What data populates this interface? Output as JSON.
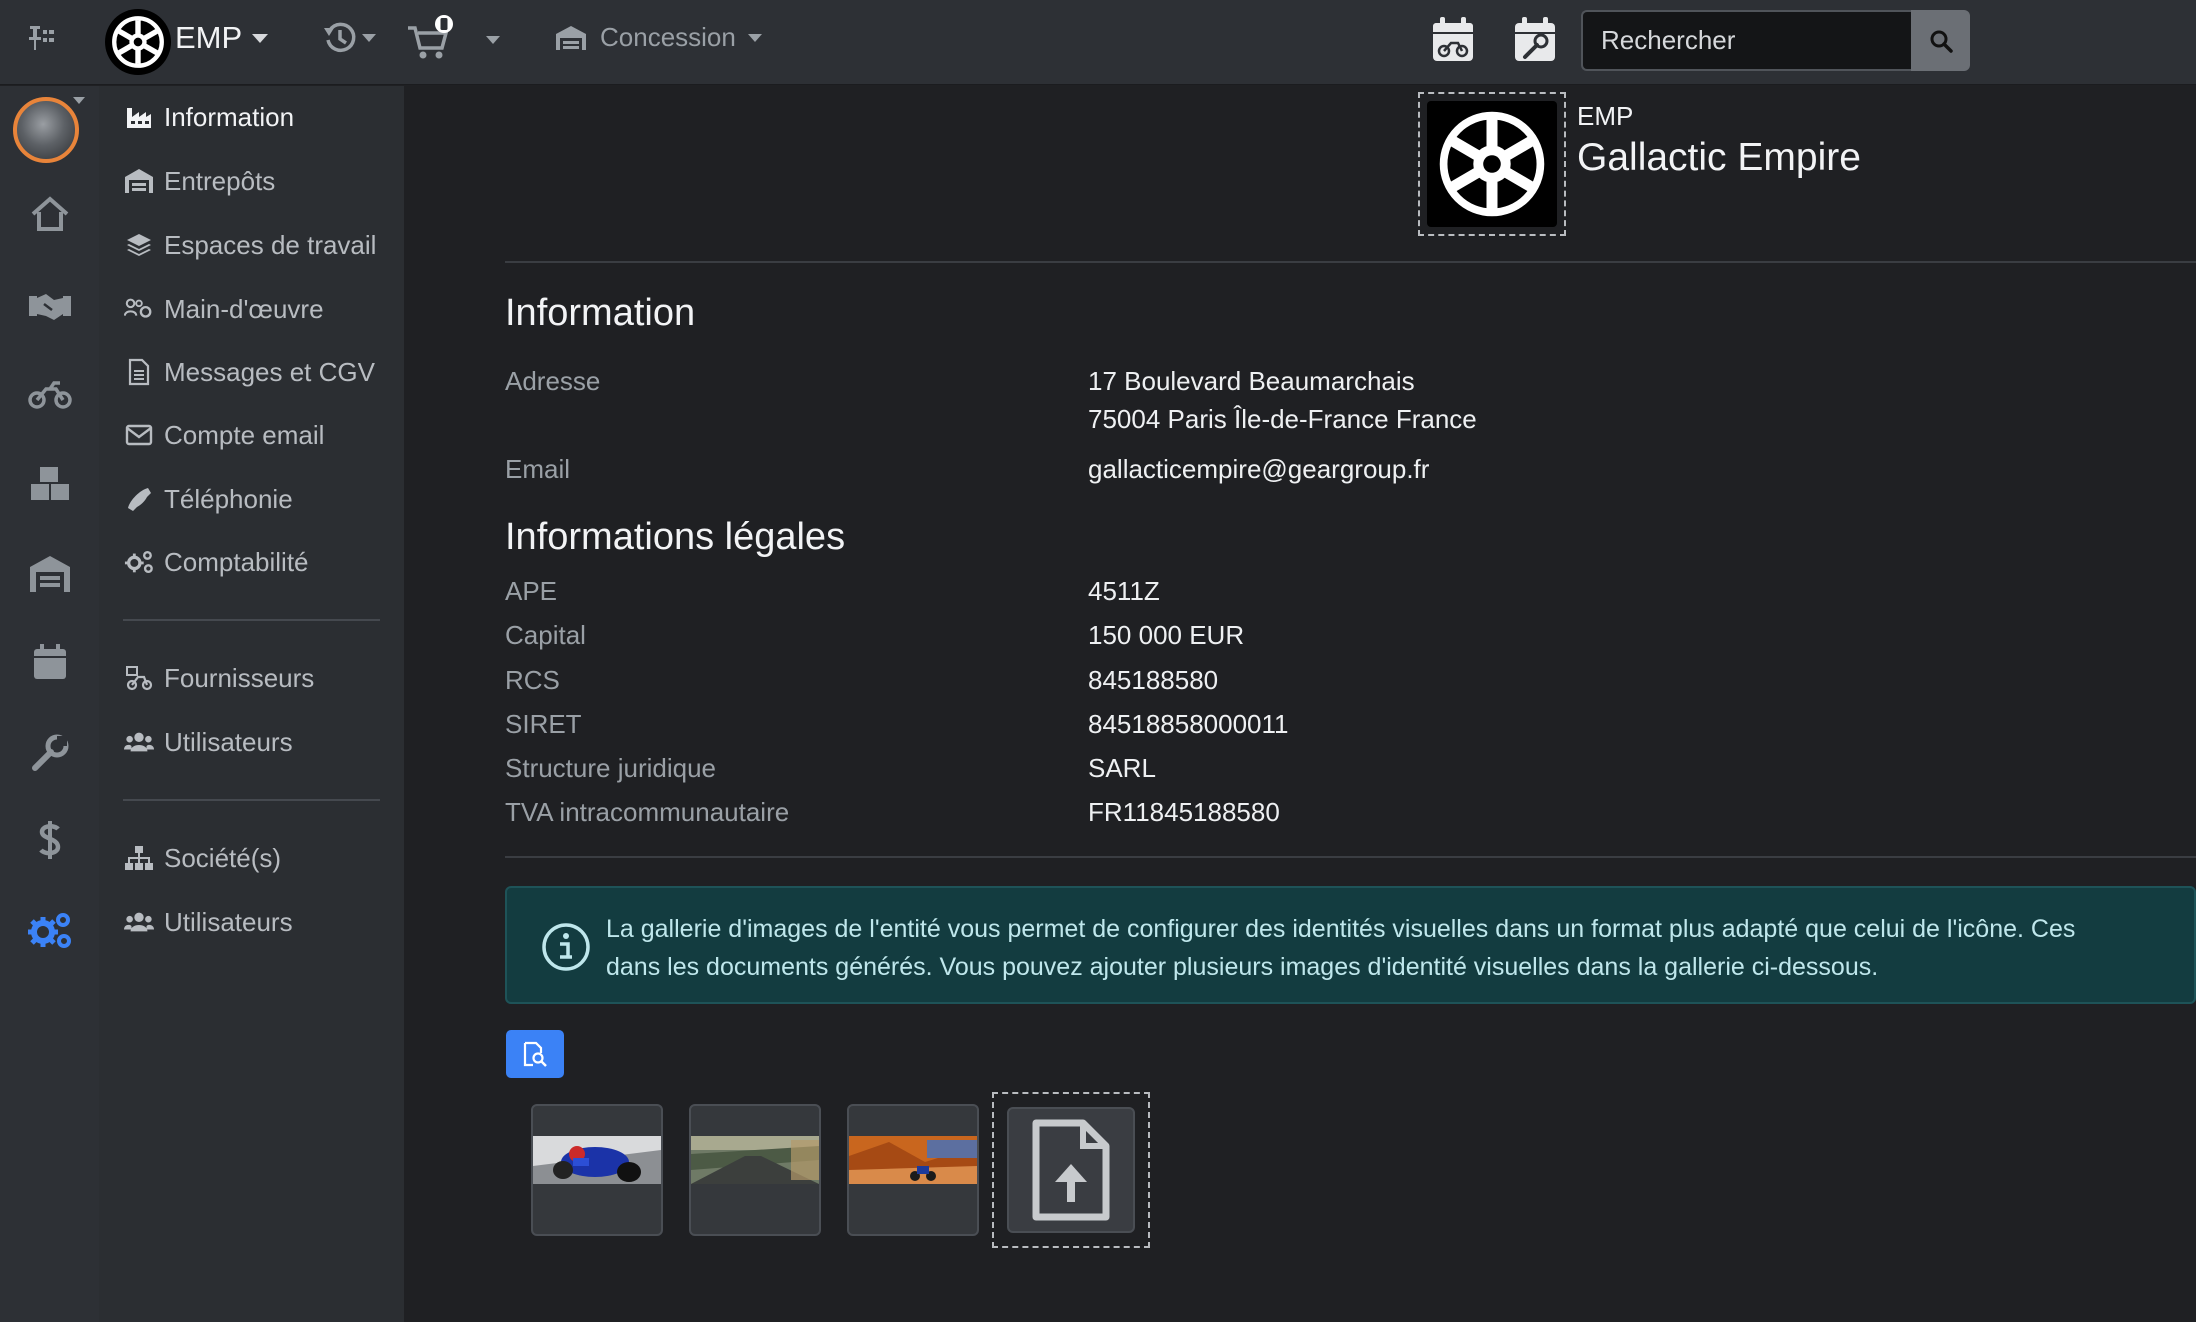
{
  "topbar": {
    "brand_label": "EMP",
    "concession_label": "Concession",
    "search": {
      "placeholder": "Rechercher"
    },
    "icons": [
      "pin-icon",
      "empire-logo-icon",
      "history-icon",
      "cart-icon",
      "phone-badge-icon",
      "store-icon",
      "calendar-moto-icon",
      "calendar-wrench-icon",
      "search-icon"
    ]
  },
  "rail": {
    "items": [
      "home-icon",
      "handshake-icon",
      "motorcycle-icon",
      "boxes-icon",
      "warehouse-icon",
      "calendar-icon",
      "wrench-icon",
      "dollar-icon",
      "cogs-icon"
    ],
    "active_color": "#3b82f6"
  },
  "sidenav": {
    "items": [
      {
        "label": "Information",
        "icon": "industry-icon"
      },
      {
        "label": "Entrepôts",
        "icon": "warehouse-icon"
      },
      {
        "label": "Espaces de travail",
        "icon": "layers-icon"
      },
      {
        "label": "Main-d'œuvre",
        "icon": "users-cog-icon"
      },
      {
        "label": "Messages et CGV",
        "icon": "file-icon"
      },
      {
        "label": "Compte email",
        "icon": "envelope-icon"
      },
      {
        "label": "Téléphonie",
        "icon": "phone-icon"
      },
      {
        "label": "Comptabilité",
        "icon": "cogs-icon"
      }
    ],
    "group2": [
      {
        "label": "Fournisseurs",
        "icon": "supplier-icon"
      },
      {
        "label": "Utilisateurs",
        "icon": "users-icon"
      }
    ],
    "group3": [
      {
        "label": "Société(s)",
        "icon": "sitemap-icon"
      },
      {
        "label": "Utilisateurs",
        "icon": "users-icon"
      }
    ]
  },
  "org": {
    "code": "EMP",
    "name": "Gallactic Empire"
  },
  "information": {
    "title": "Information",
    "address_label": "Adresse",
    "address_line1": "17 Boulevard Beaumarchais",
    "address_line2": "75004 Paris Île-de-France France",
    "email_label": "Email",
    "email": "gallacticempire@geargroup.fr"
  },
  "legal": {
    "title": "Informations légales",
    "rows": [
      {
        "label": "APE",
        "value": "4511Z"
      },
      {
        "label": "Capital",
        "value": "150 000 EUR"
      },
      {
        "label": "RCS",
        "value": "845188580"
      },
      {
        "label": "SIRET",
        "value": "84518858000011"
      },
      {
        "label": "Structure juridique",
        "value": "SARL"
      },
      {
        "label": "TVA intracommunautaire",
        "value": "FR11845188580"
      }
    ]
  },
  "gallery": {
    "notice_line1": "La gallerie d'images de l'entité vous permet de configurer des identités visuelles dans un format plus adapté que celui de l'icône. Ces",
    "notice_line2": "dans les documents générés. Vous pouvez ajouter plusieurs images d'identité visuelles dans la gallerie ci-dessous.",
    "thumbnails": [
      "moto-racer-image",
      "road-landscape-image",
      "desert-moto-image"
    ]
  }
}
